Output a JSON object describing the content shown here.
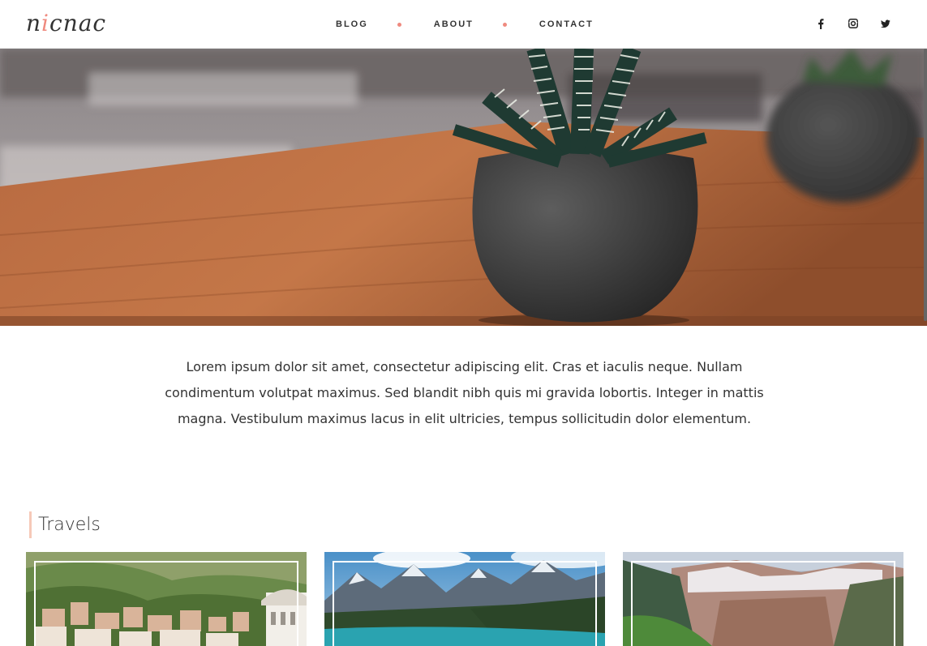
{
  "header": {
    "logo": {
      "part1": "n",
      "accent": "i",
      "part2": "cnac"
    },
    "nav": [
      {
        "label": "BLOG"
      },
      {
        "label": "ABOUT"
      },
      {
        "label": "CONTACT"
      }
    ],
    "social_icons": [
      "facebook-icon",
      "instagram-icon",
      "twitter-icon"
    ],
    "accent_color": "#ef8a7f"
  },
  "intro": {
    "text": "Lorem ipsum dolor sit amet, consectetur adipiscing elit. Cras et iaculis neque. Nullam condimentum volutpat maximus. Sed blandit nibh quis mi gravida lobortis. Integer in mattis magna. Vestibulum maximus lacus in elit ultricies, tempus sollicitudin dolor elementum."
  },
  "travels": {
    "title": "Travels"
  }
}
